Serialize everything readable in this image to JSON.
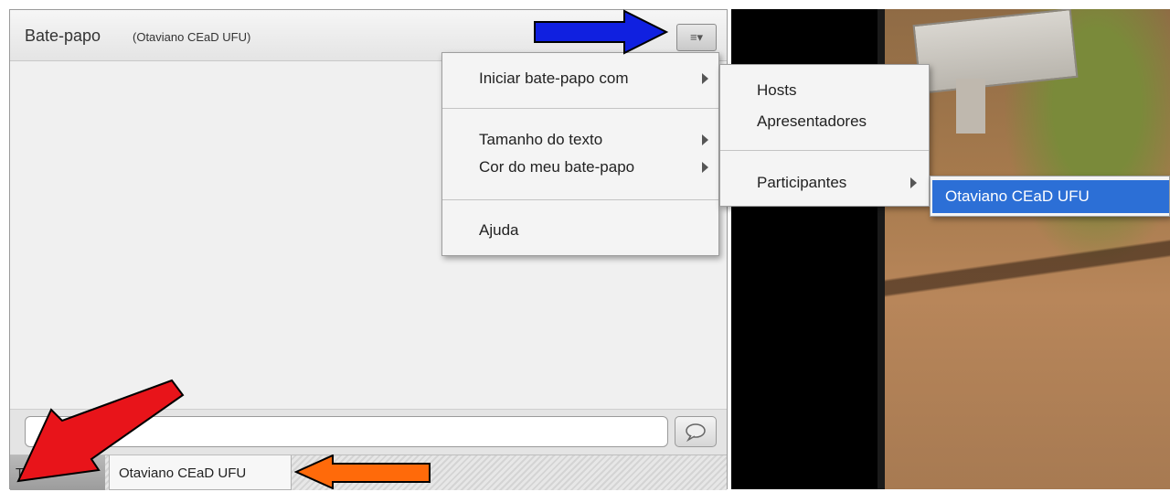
{
  "chat_pod": {
    "title": "Bate-papo",
    "subtitle": "(Otaviano CEaD UFU)",
    "menu_button_icon": "≡▾",
    "input_placeholder": ""
  },
  "tabs": [
    {
      "label": "Todos"
    },
    {
      "label": "Otaviano CEaD UFU"
    }
  ],
  "menu": {
    "items": [
      {
        "label": "Iniciar bate-papo com",
        "has_submenu": true
      },
      {
        "label": "Tamanho do texto",
        "has_submenu": true
      },
      {
        "label": "Cor do meu bate-papo",
        "has_submenu": true
      },
      {
        "label": "Ajuda",
        "has_submenu": false
      }
    ]
  },
  "submenu": {
    "items": [
      {
        "label": "Hosts",
        "has_submenu": false
      },
      {
        "label": "Apresentadores",
        "has_submenu": false
      },
      {
        "label": "Participantes",
        "has_submenu": true
      }
    ]
  },
  "submenu2": {
    "items": [
      {
        "label": "Otaviano CEaD UFU",
        "highlighted": true
      }
    ]
  },
  "colors": {
    "highlight": "#2c6fd6",
    "arrow_blue": "#1020e0",
    "arrow_red": "#e8141a",
    "arrow_orange": "#ff6a0a"
  }
}
